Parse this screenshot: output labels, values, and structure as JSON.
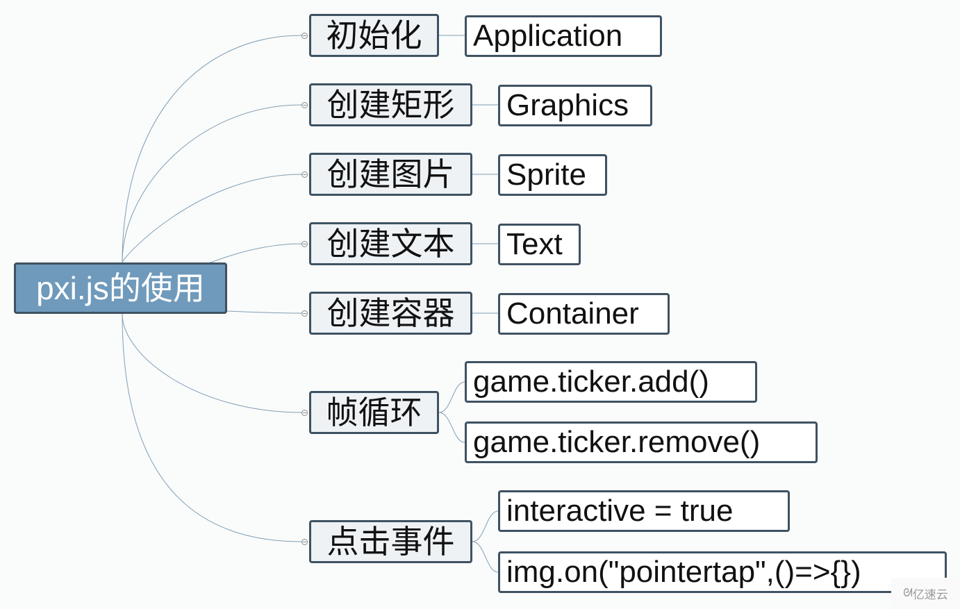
{
  "title": "pxi.js的使用",
  "root": {
    "label": "pxi.js的使用"
  },
  "branches": [
    {
      "label": "初始化",
      "children": [
        "Application"
      ]
    },
    {
      "label": "创建矩形",
      "children": [
        "Graphics"
      ]
    },
    {
      "label": "创建图片",
      "children": [
        "Sprite"
      ]
    },
    {
      "label": "创建文本",
      "children": [
        "Text"
      ]
    },
    {
      "label": "创建容器",
      "children": [
        "Container"
      ]
    },
    {
      "label": "帧循环",
      "children": [
        "game.ticker.add()",
        "game.ticker.remove()"
      ]
    },
    {
      "label": "点击事件",
      "children": [
        "interactive = true",
        "img.on(\"pointertap\",()=>{})"
      ]
    }
  ],
  "watermark": {
    "logo": "ᘛ",
    "text": "亿速云"
  },
  "colors": {
    "root_fill": "#6f9abb",
    "node_border": "#3e5262",
    "branch_fill": "#eef2f5",
    "link": "#7f9fb5"
  }
}
